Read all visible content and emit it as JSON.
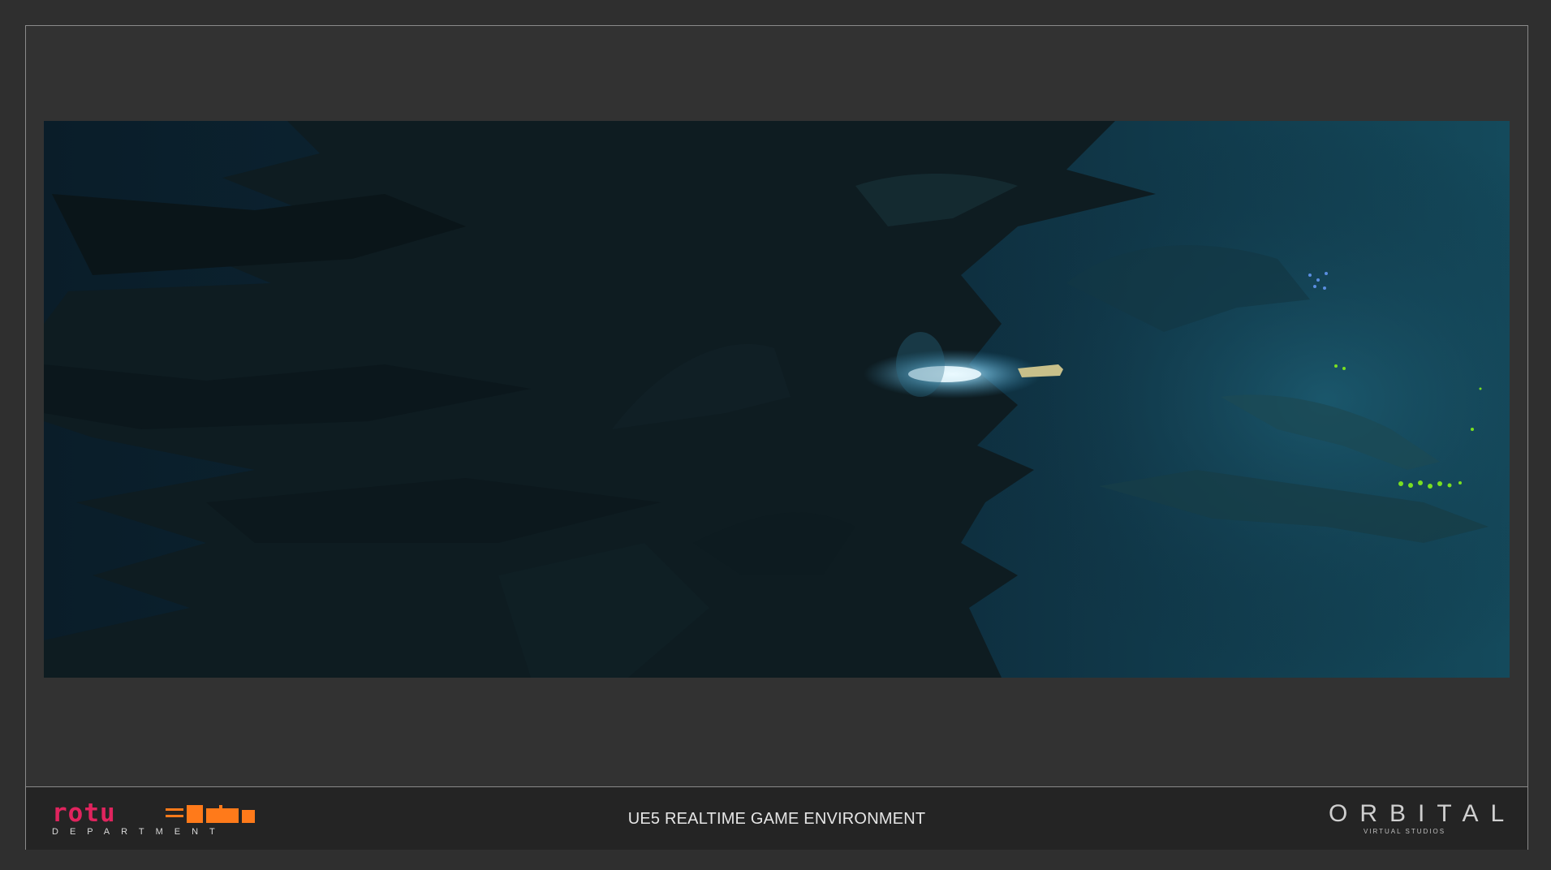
{
  "footer": {
    "title": "UE5 REALTIME GAME ENVIRONMENT",
    "left_logo": {
      "wordmark": "rotu",
      "subtitle": "DEPARTMENT",
      "colors": {
        "primary": "#e0245e",
        "secondary": "#ff7a1a"
      }
    },
    "right_logo": {
      "wordmark": "ORBITAL",
      "subtitle": "VIRTUAL STUDIOS",
      "color": "#cfcfcf"
    }
  },
  "scene": {
    "description_icon": "underwater-cave-render",
    "palette": {
      "deep": "#0b2230",
      "teal": "#14475a",
      "rock": "#0e1d22",
      "light": "#bfe8ff",
      "glow": "#7ae020"
    }
  }
}
